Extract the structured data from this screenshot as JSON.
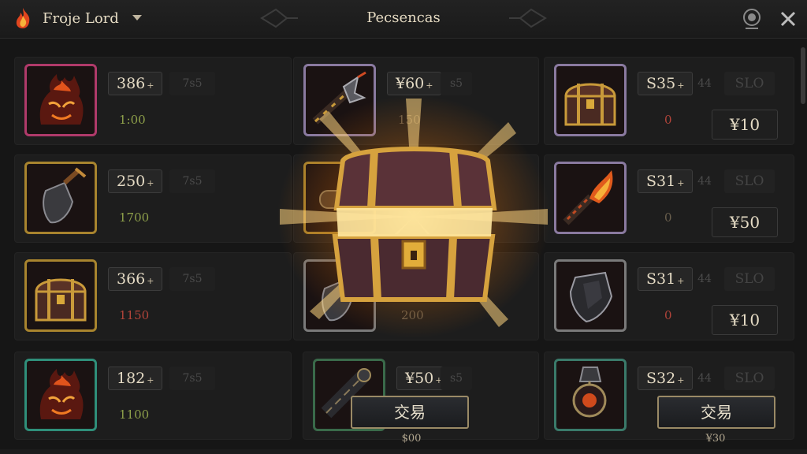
{
  "header": {
    "player_name": "Froje Lord",
    "title": "Pecsencas",
    "icons": [
      "fire-icon",
      "chevron-down-icon",
      "map-pin-icon",
      "close-icon"
    ]
  },
  "colors": {
    "background": "#161616",
    "gold": "#c99a3a",
    "green_text": "#8ea04a",
    "red_text": "#b2443a"
  },
  "left_column": [
    {
      "item_icon": "fire-demon-icon",
      "frame_color": "#b03a6a",
      "price": "386",
      "plus": "+",
      "ghost": "7s5",
      "sub": "1:00",
      "sub_color": "green"
    },
    {
      "item_icon": "shovel-icon",
      "frame_color": "#a8842e",
      "price": "250",
      "plus": "+",
      "ghost": "7s5",
      "sub": "1700",
      "sub_color": "green"
    },
    {
      "item_icon": "treasure-chest-icon",
      "frame_color": "#a8842e",
      "price": "366",
      "plus": "+",
      "ghost": "7s5",
      "sub": "1150",
      "sub_color": "red"
    },
    {
      "item_icon": "fire-demon-icon",
      "frame_color": "#2f8f7a",
      "price": "182",
      "plus": "+",
      "ghost": "7s5",
      "sub": "1100",
      "sub_color": "green"
    }
  ],
  "middle_column": [
    {
      "item_icon": "spiked-club-icon",
      "frame_color": "#8a7aa0",
      "price": "¥60",
      "plus": "+",
      "ghost": "s5",
      "sub": "150"
    },
    {
      "item_icon": "scroll-icon",
      "frame_color": "#a8842e",
      "price": "",
      "plus": "",
      "ghost": "",
      "sub": ""
    },
    {
      "item_icon": "shovel-icon",
      "frame_color": "#7a7a7a",
      "price": "",
      "plus": "",
      "ghost": "",
      "sub": "200"
    },
    {
      "item_icon": "cannon-icon",
      "frame_color": "#3a6a4a",
      "price": "¥50",
      "plus": "+",
      "ghost": "s5",
      "sub": ""
    }
  ],
  "right_column": [
    {
      "item_icon": "treasure-chest-icon",
      "frame_color": "#8a7aa0",
      "price": "S35",
      "plus": "+",
      "ghost": "44",
      "slot": "SLO",
      "sub": "0",
      "yen": "¥10"
    },
    {
      "item_icon": "flaming-sword-icon",
      "frame_color": "#8a7aa0",
      "price": "S31",
      "plus": "+",
      "ghost": "44",
      "slot": "SLO",
      "sub": "0",
      "yen": "¥50"
    },
    {
      "item_icon": "shield-icon",
      "frame_color": "#7a7a7a",
      "price": "S31",
      "plus": "+",
      "ghost": "44",
      "slot": "SLO",
      "sub": "0",
      "yen": "¥10"
    },
    {
      "item_icon": "amulet-icon",
      "frame_color": "#3a7a6a",
      "price": "S32",
      "plus": "+",
      "ghost": "44",
      "slot": "SLO",
      "sub": "",
      "yen": ""
    }
  ],
  "trade": {
    "middle_label": "交易",
    "middle_price": "$00",
    "right_label": "交易",
    "right_price": "¥30"
  },
  "featured": {
    "icon": "glowing-treasure-chest-icon"
  }
}
